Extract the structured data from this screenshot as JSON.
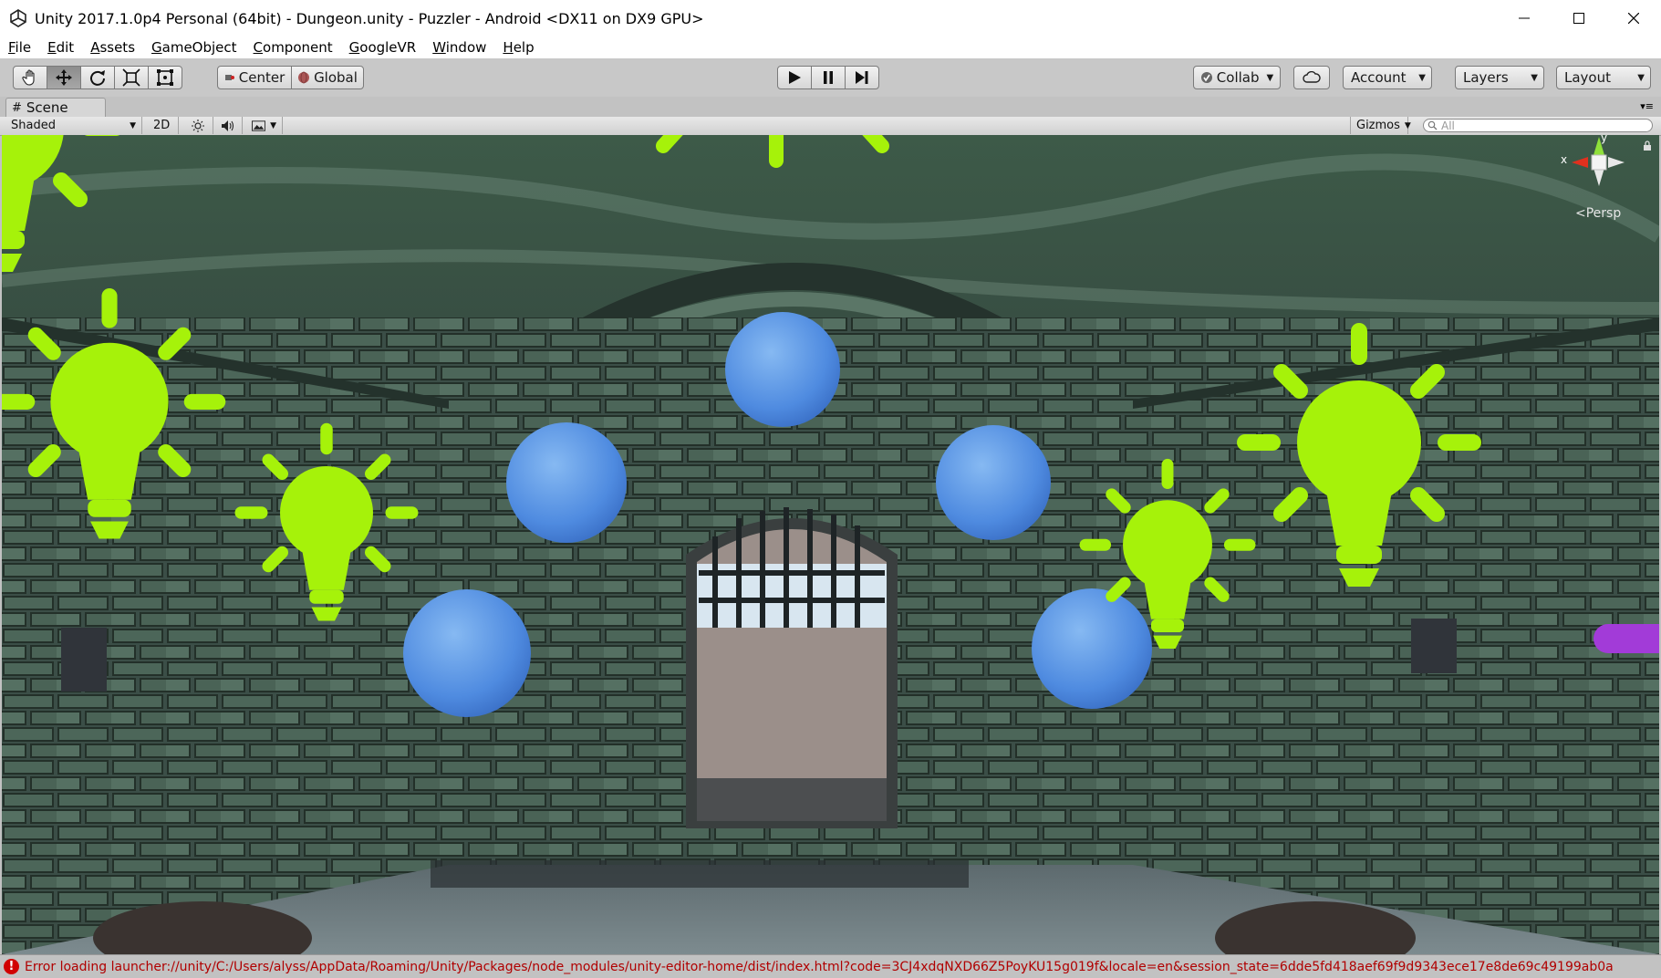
{
  "window": {
    "title": "Unity 2017.1.0p4 Personal (64bit) - Dungeon.unity - Puzzler - Android <DX11 on DX9 GPU>"
  },
  "menu": [
    "File",
    "Edit",
    "Assets",
    "GameObject",
    "Component",
    "GoogleVR",
    "Window",
    "Help"
  ],
  "toolbar": {
    "pivot_label": "Center",
    "space_label": "Global",
    "collab_label": "Collab",
    "account_label": "Account",
    "layers_label": "Layers",
    "layout_label": "Layout"
  },
  "scene_tab": {
    "label": "Scene"
  },
  "scene_toolbar": {
    "shading_mode": "Shaded",
    "mode_2d": "2D",
    "gizmos_label": "Gizmos",
    "search_placeholder": "All"
  },
  "gizmo": {
    "x_label": "x",
    "y_label": "y",
    "projection_label": "Persp"
  },
  "status": {
    "error_text": "Error loading launcher://unity/C:/Users/alyss/AppData/Roaming/Unity/Packages/node_modules/unity-editor-home/dist/index.html?code=3CJ4xdqNXD66Z5PoyKU15g019f&locale=en&session_state=6dde5fd418aef69f9d9343ece17e8de69c49199ab0a"
  },
  "colors": {
    "light_icon": "#a6f20a",
    "sphere": "#5a97e6",
    "error": "#b00000",
    "x_axis": "#e0301e",
    "y_axis": "#8fe03a"
  }
}
